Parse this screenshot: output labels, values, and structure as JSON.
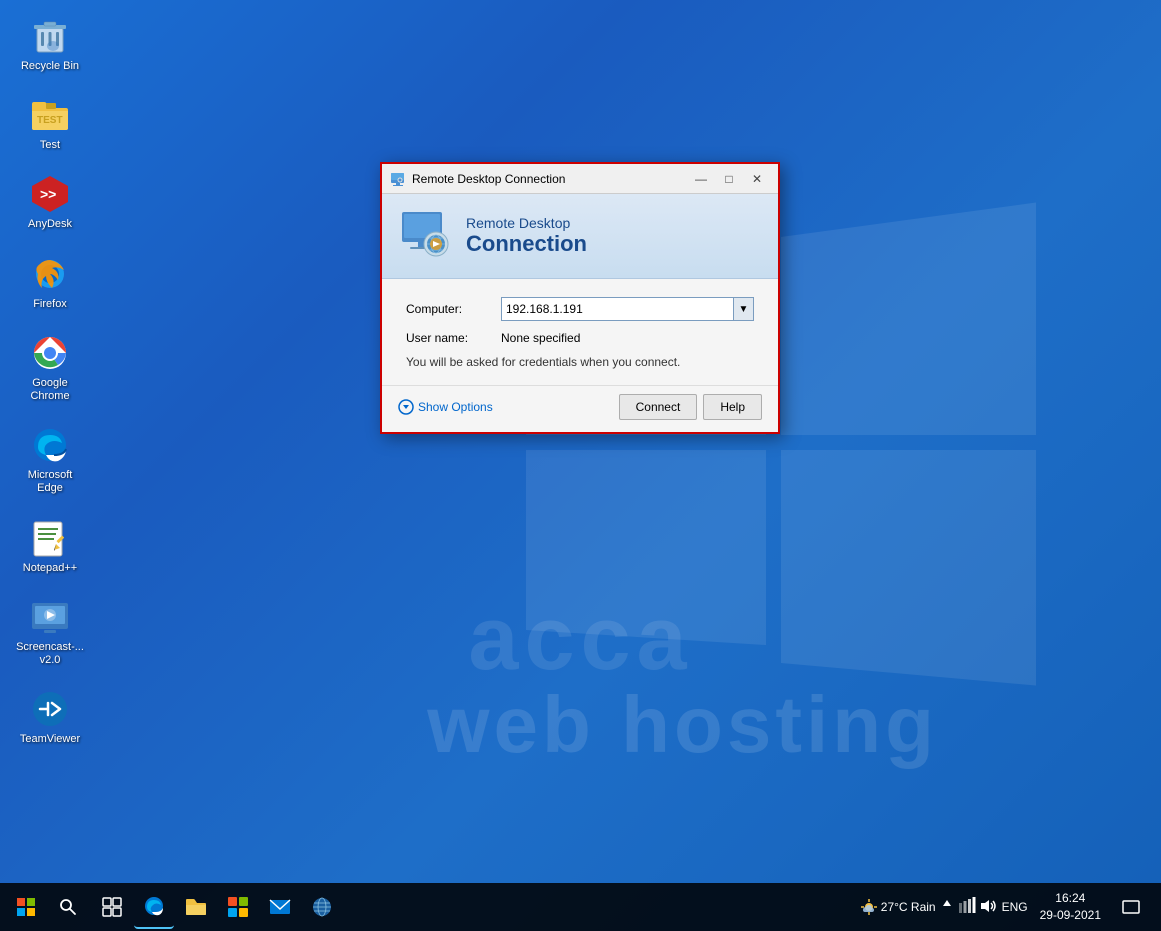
{
  "desktop": {
    "background_color": "#1565c0"
  },
  "icons": [
    {
      "id": "recycle-bin",
      "label": "Recycle Bin",
      "icon": "🗑️"
    },
    {
      "id": "test-folder",
      "label": "Test",
      "icon": "📁"
    },
    {
      "id": "anydesk",
      "label": "AnyDesk",
      "icon": "📡"
    },
    {
      "id": "firefox",
      "label": "Firefox",
      "icon": "🦊"
    },
    {
      "id": "google-chrome",
      "label": "Google Chrome",
      "icon": "🌐"
    },
    {
      "id": "microsoft-edge",
      "label": "Microsoft Edge",
      "icon": "🌊"
    },
    {
      "id": "notepadpp",
      "label": "Notepad++",
      "icon": "📝"
    },
    {
      "id": "screencast",
      "label": "Screencast-... v2.0",
      "icon": "📹"
    },
    {
      "id": "teamviewer",
      "label": "TeamViewer",
      "icon": "🔁"
    }
  ],
  "watermark": {
    "line1": "acca",
    "line2": "web hosting"
  },
  "dialog": {
    "title": "Remote Desktop Connection",
    "heading_line1": "Remote Desktop",
    "heading_line2": "Connection",
    "computer_label": "Computer:",
    "computer_value": "192.168.1.191",
    "username_label": "User name:",
    "username_value": "None specified",
    "hint_text": "You will be asked for credentials when you connect.",
    "show_options_label": "Show Options",
    "connect_label": "Connect",
    "help_label": "Help",
    "window_controls": {
      "minimize": "—",
      "maximize": "□",
      "close": "✕"
    }
  },
  "taskbar": {
    "tray": {
      "weather": "27°C Rain",
      "language": "ENG",
      "time": "16:24",
      "date": "29-09-2021"
    }
  }
}
